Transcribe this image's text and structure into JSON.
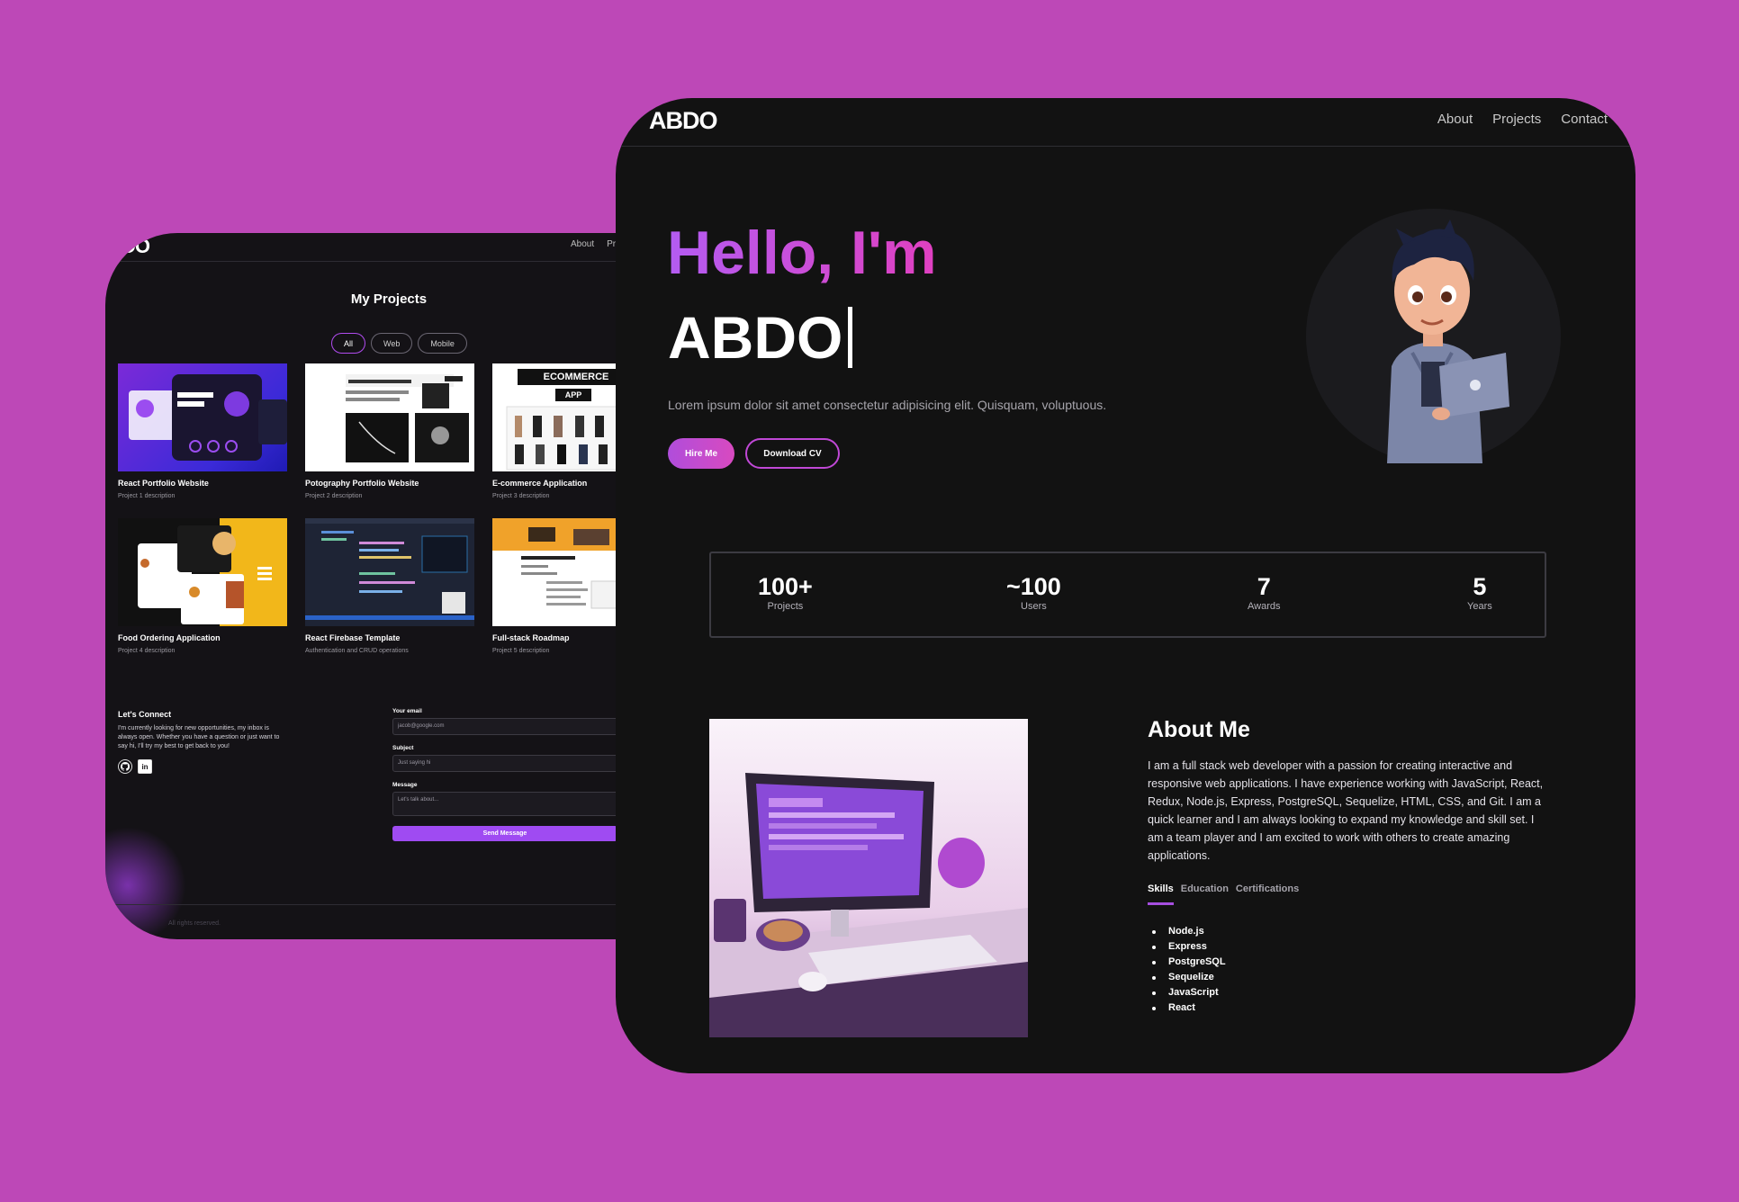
{
  "back": {
    "logo": "DO",
    "nav": [
      "About",
      "Pro"
    ],
    "projects_title": "My Projects",
    "filters": [
      "All",
      "Web",
      "Mobile"
    ],
    "projects": [
      {
        "name": "React Portfolio Website",
        "desc": "Project 1 description"
      },
      {
        "name": "Potography Portfolio Website",
        "desc": "Project 2 description"
      },
      {
        "name": "E-commerce Application",
        "desc": "Project 3 description",
        "thumb_banner": "ECOMMERCE",
        "thumb_sub": "APP"
      },
      {
        "name": "Food Ordering Application",
        "desc": "Project 4 description"
      },
      {
        "name": "React Firebase Template",
        "desc": "Authentication and CRUD operations"
      },
      {
        "name": "Full-stack Roadmap",
        "desc": "Project 5 description"
      }
    ],
    "connect": {
      "title": "Let's Connect",
      "text": "I'm currently looking for new opportunities, my inbox is always open. Whether you have a question or just want to say hi, I'll try my best to get back to you!"
    },
    "form": {
      "email_label": "Your email",
      "email_placeholder": "jacob@google.com",
      "subject_label": "Subject",
      "subject_placeholder": "Just saying hi",
      "message_label": "Message",
      "message_placeholder": "Let's talk about...",
      "send_label": "Send Message"
    },
    "footer": "All rights reserved."
  },
  "front": {
    "logo": "ABDO",
    "nav": [
      "About",
      "Projects",
      "Contact"
    ],
    "hello": "Hello, I'm",
    "name": "ABDO",
    "hero_text": "Lorem ipsum dolor sit amet consectetur adipisicing elit. Quisquam, voluptuous.",
    "hire_label": "Hire Me",
    "cv_label": "Download CV",
    "stats": [
      {
        "value": "100+",
        "label": "Projects"
      },
      {
        "value": "~100",
        "label": "Users"
      },
      {
        "value": "7",
        "label": "Awards"
      },
      {
        "value": "5",
        "label": "Years"
      }
    ],
    "about_title": "About Me",
    "about_text": "I am a full stack web developer with a passion for creating interactive and responsive web applications. I have experience working with JavaScript, React, Redux, Node.js, Express, PostgreSQL, Sequelize, HTML, CSS, and Git. I am a quick learner and I am always looking to expand my knowledge and skill set. I am a team player and I am excited to work with others to create amazing applications.",
    "tabs": [
      "Skills",
      "Education",
      "Certifications"
    ],
    "skills": [
      "Node.js",
      "Express",
      "PostgreSQL",
      "Sequelize",
      "JavaScript",
      "React"
    ]
  },
  "colors": {
    "background": "#bd48b7",
    "panel": "#121212",
    "accent_purple": "#b35cf2",
    "accent_pink": "#e040c0"
  }
}
